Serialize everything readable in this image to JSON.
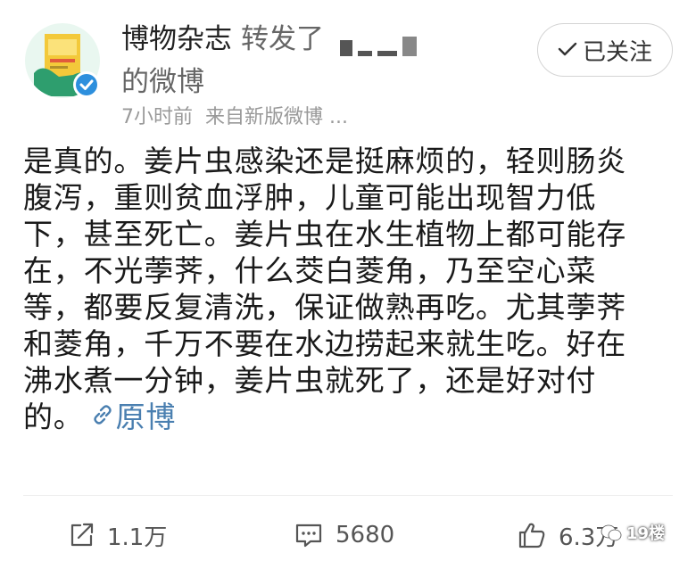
{
  "header": {
    "user_name": "博物杂志",
    "repost_text": "转发了",
    "repost_suffix": "的微博",
    "time": "7小时前",
    "source": "来自新版微博 ...",
    "follow_label": "已关注"
  },
  "post": {
    "lines": [
      "是真的。姜片虫感染还是挺麻烦的，轻则肠炎",
      "腹泻，重则贫血浮肿，儿童可能出现智力低",
      "下，甚至死亡。姜片虫在水生植物上都可能存",
      "在，不光荸荠，什么茭白菱角，乃至空心菜",
      "等，都要反复清洗，保证做熟再吃。尤其荸荠",
      "和菱角，千万不要在水边捞起来就生吃。好在",
      "沸水煮一分钟，姜片虫就死了，还是好对付"
    ],
    "last_line_text": "的。",
    "original_link_label": "原博"
  },
  "actions": {
    "share_count": "1.1万",
    "comment_count": "5680",
    "like_count": "6.3万"
  },
  "watermark": {
    "label": "19楼"
  },
  "icons": {
    "avatar": "magazine-avatar",
    "verified": "verified-check-icon",
    "follow_check": "check-icon",
    "link": "link-icon",
    "share": "share-icon",
    "comment": "comment-icon",
    "like": "thumbs-up-icon",
    "watermark_logo": "watermark-logo-icon"
  },
  "colors": {
    "link": "#4a7fb0",
    "verified": "#2d8fdd",
    "text": "#1a1a1a",
    "secondary_text": "#666666",
    "meta_text": "#999999"
  }
}
